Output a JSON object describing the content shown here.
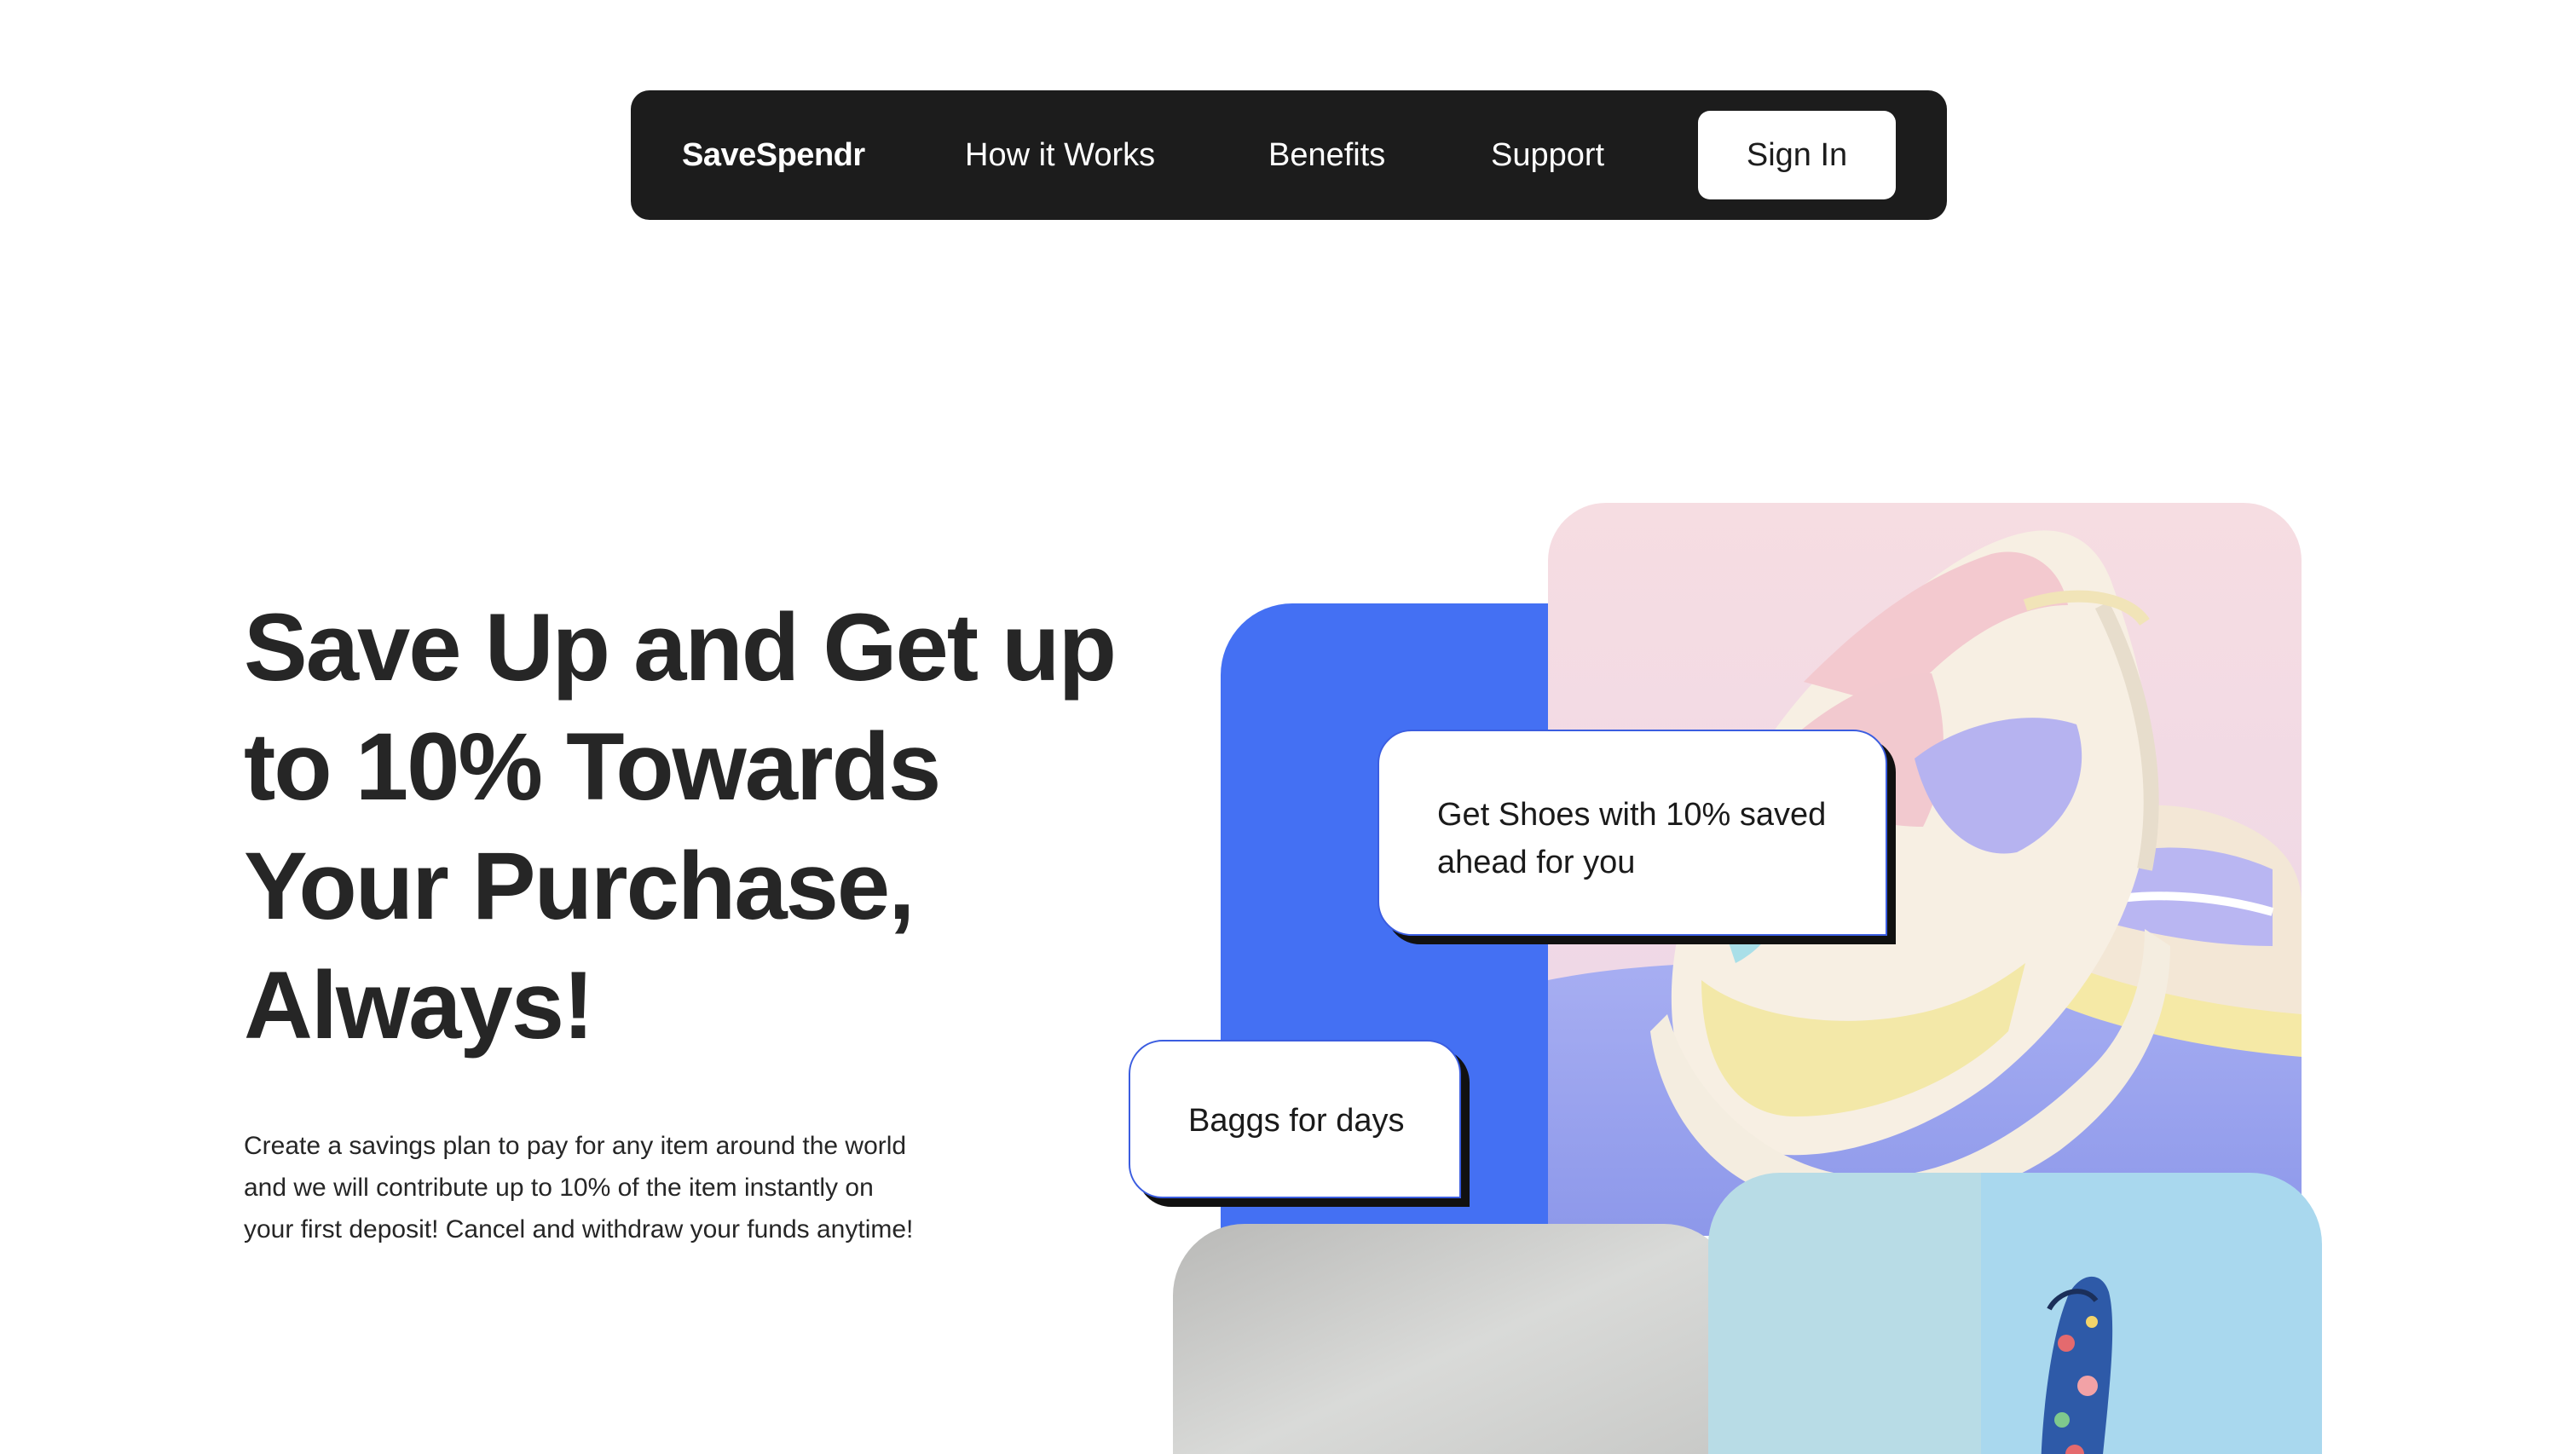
{
  "navbar": {
    "brand": "SaveSpendr",
    "links": [
      {
        "label": "How it Works"
      },
      {
        "label": "Benefits"
      },
      {
        "label": "Support"
      }
    ],
    "signin_label": "Sign In"
  },
  "hero": {
    "title": "Save Up and Get up to 10% Towards Your Purchase, Always!",
    "subtitle": "Create a savings plan to pay for any item around the world and we will contribute up to 10% of the item instantly on your first deposit! Cancel and withdraw your funds anytime!"
  },
  "collage": {
    "callout_shoes": "Get Shoes with 10% saved ahead for you",
    "callout_bags": "Baggs for days"
  },
  "colors": {
    "navbar_bg": "#1c1c1c",
    "accent_blue": "#4470f3",
    "text_dark": "#262626"
  }
}
